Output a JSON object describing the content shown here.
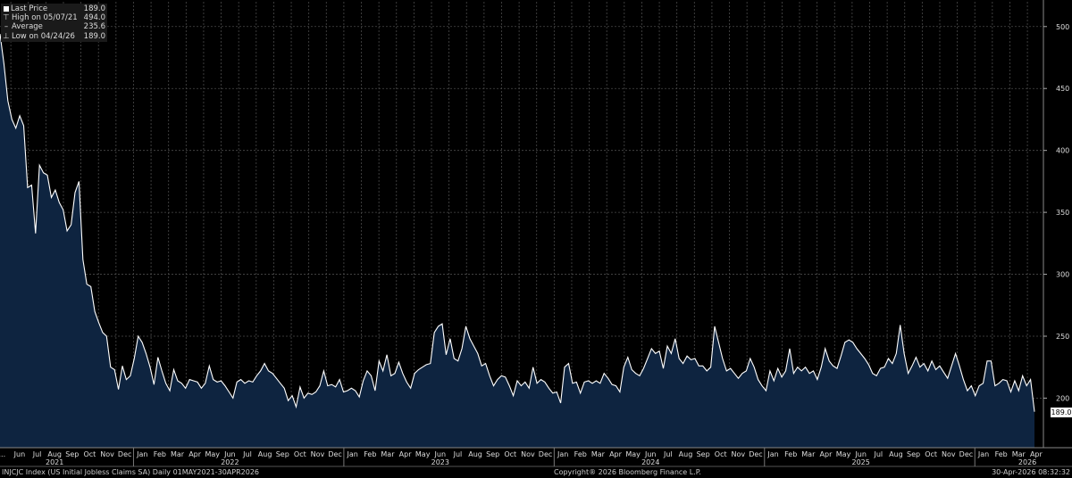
{
  "legend": {
    "last_price": {
      "label": "Last Price",
      "value": "189.0"
    },
    "high": {
      "label": "High on 05/07/21",
      "value": "494.0"
    },
    "average": {
      "label": "Average",
      "value": "235.6"
    },
    "low": {
      "label": "Low on 04/24/26",
      "value": "189.0"
    }
  },
  "last_value_tag": "189.0",
  "footer": {
    "left": "INJCJC Index (US Initial Jobless Claims SA) Daily 01MAY2021-30APR2026",
    "center": "Copyright® 2026 Bloomberg Finance L.P.",
    "right": "30-Apr-2026 08:32:32"
  },
  "colors": {
    "background": "#000000",
    "line": "#ffffff",
    "area": "#0e2440",
    "grid": "#4a4a4a"
  },
  "chart_data": {
    "type": "area",
    "title": "",
    "xlabel": "",
    "ylabel": "",
    "y_ticks": [
      200,
      250,
      300,
      350,
      400,
      450,
      500
    ],
    "ylim": [
      160,
      520
    ],
    "grid": "vertical dashed at month boundaries, horizontal at y ticks",
    "month_labels": [
      "...",
      "Jun",
      "Jul",
      "Aug",
      "Sep",
      "Oct",
      "Nov",
      "Dec",
      "Jan",
      "Feb",
      "Mar",
      "Apr",
      "May",
      "Jun",
      "Jul",
      "Aug",
      "Sep",
      "Oct",
      "Nov",
      "Dec",
      "Jan",
      "Feb",
      "Mar",
      "Apr",
      "May",
      "Jun",
      "Jul",
      "Aug",
      "Sep",
      "Oct",
      "Nov",
      "Dec",
      "Jan",
      "Feb",
      "Mar",
      "Apr",
      "May",
      "Jun",
      "Jul",
      "Aug",
      "Sep",
      "Oct",
      "Nov",
      "Dec",
      "Jan",
      "Feb",
      "Mar",
      "Apr",
      "May",
      "Jun",
      "Jul",
      "Aug",
      "Sep",
      "Oct",
      "Nov",
      "Dec",
      "Jan",
      "Feb",
      "Mar",
      "Apr"
    ],
    "year_labels": [
      {
        "label": "2021",
        "month_index": 3.5
      },
      {
        "label": "2022",
        "month_index": 13.5
      },
      {
        "label": "2023",
        "month_index": 25.5
      },
      {
        "label": "2024",
        "month_index": 37.5
      },
      {
        "label": "2025",
        "month_index": 49.5
      },
      {
        "label": "2026",
        "month_index": 59
      }
    ],
    "year_boundaries": [
      8,
      20,
      32,
      44,
      56
    ],
    "series": [
      {
        "values": [
          494,
          470,
          440,
          425,
          418,
          428,
          420,
          370,
          372,
          333,
          388,
          382,
          380,
          362,
          368,
          358,
          352,
          335,
          340,
          366,
          375,
          312,
          292,
          290,
          270,
          261,
          253,
          250,
          225,
          223,
          207,
          226,
          215,
          218,
          232,
          250,
          245,
          236,
          225,
          211,
          233,
          222,
          212,
          206,
          223,
          214,
          212,
          208,
          215,
          214,
          213,
          208,
          212,
          226,
          215,
          213,
          214,
          210,
          205,
          200,
          213,
          215,
          212,
          214,
          213,
          218,
          222,
          228,
          222,
          220,
          216,
          212,
          208,
          198,
          202,
          193,
          209,
          200,
          204,
          203,
          205,
          210,
          222,
          210,
          211,
          209,
          215,
          205,
          206,
          208,
          206,
          201,
          214,
          222,
          218,
          206,
          230,
          222,
          235,
          218,
          220,
          229,
          220,
          213,
          208,
          220,
          223,
          225,
          227,
          228,
          253,
          258,
          260,
          235,
          248,
          232,
          230,
          240,
          258,
          248,
          242,
          236,
          226,
          228,
          218,
          210,
          215,
          218,
          217,
          210,
          202,
          214,
          210,
          213,
          208,
          225,
          212,
          215,
          213,
          208,
          204,
          205,
          196,
          225,
          228,
          212,
          213,
          204,
          213,
          214,
          212,
          214,
          212,
          220,
          216,
          211,
          210,
          205,
          225,
          233,
          223,
          220,
          218,
          224,
          232,
          240,
          236,
          238,
          224,
          242,
          236,
          248,
          232,
          228,
          234,
          231,
          232,
          226,
          226,
          222,
          225,
          258,
          245,
          232,
          222,
          224,
          220,
          216,
          220,
          222,
          232,
          225,
          215,
          210,
          206,
          222,
          214,
          224,
          217,
          222,
          240,
          220,
          225,
          222,
          225,
          220,
          222,
          215,
          225,
          240,
          230,
          226,
          224,
          234,
          245,
          247,
          245,
          240,
          236,
          232,
          227,
          220,
          218,
          224,
          225,
          232,
          228,
          236,
          259,
          236,
          220,
          226,
          233,
          225,
          228,
          222,
          230,
          223,
          226,
          221,
          216,
          226,
          236,
          226,
          215,
          206,
          210,
          202,
          210,
          212,
          230,
          230,
          210,
          212,
          215,
          214,
          205,
          214,
          206,
          218,
          210,
          215,
          189
        ]
      }
    ]
  }
}
